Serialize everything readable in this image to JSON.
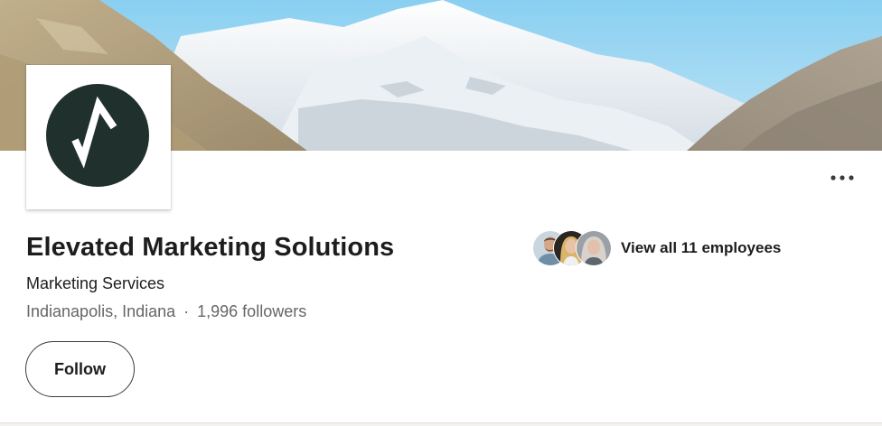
{
  "company": {
    "name": "Elevated Marketing Solutions",
    "industry": "Marketing Services",
    "location": "Indianapolis, Indiana",
    "separator": "·",
    "followers": "1,996 followers"
  },
  "actions": {
    "follow_label": "Follow",
    "more_icon": "ellipsis-icon"
  },
  "employees": {
    "link_label": "View all 11 employees",
    "avatar_count": 3
  },
  "colors": {
    "logo_circle": "#1f302d",
    "sky": "#8ed3f3",
    "text_primary": "#1d1d1d",
    "text_secondary": "#666666"
  }
}
